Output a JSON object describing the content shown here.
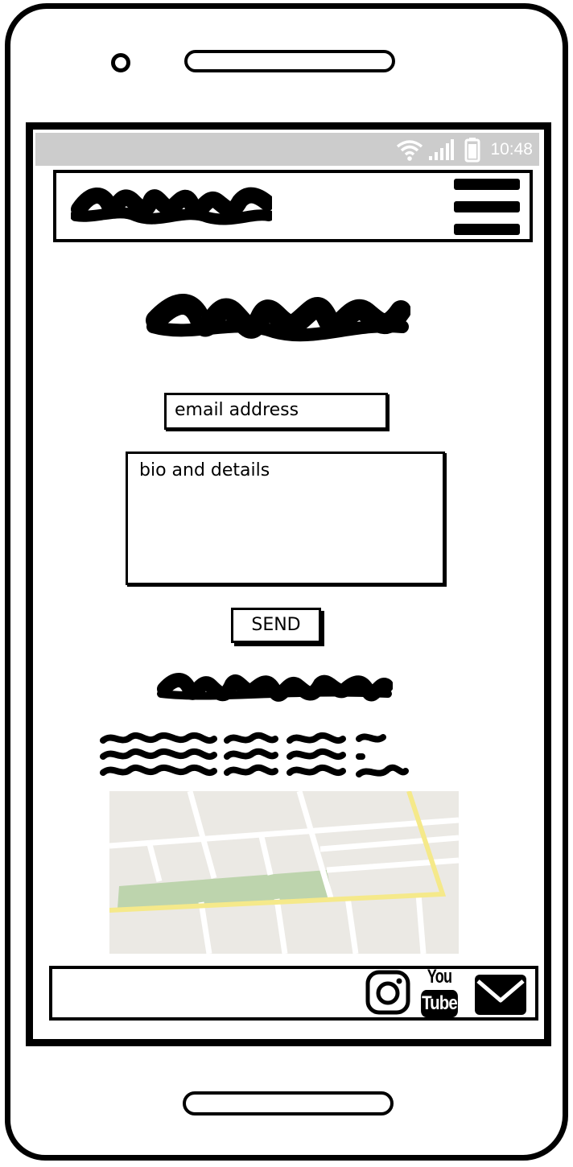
{
  "status_bar": {
    "time": "10:48",
    "icons": [
      "wifi-icon",
      "signal-icon",
      "battery-icon"
    ]
  },
  "header": {
    "logo": "scribble-placeholder",
    "menu_icon": "hamburger-icon"
  },
  "form": {
    "email_placeholder": "email address",
    "bio_placeholder": "bio and details",
    "send_label": "SEND"
  },
  "footer": {
    "social_icons": [
      "instagram-icon",
      "youtube-icon",
      "mail-icon"
    ],
    "youtube_top": "You",
    "youtube_bottom": "Tube"
  },
  "colors": {
    "status_bar_bg": "#cccccc",
    "map_land": "#ebe9e4",
    "map_park": "#bdd4ad",
    "map_highway": "#f5e98a",
    "ink": "#000000"
  }
}
